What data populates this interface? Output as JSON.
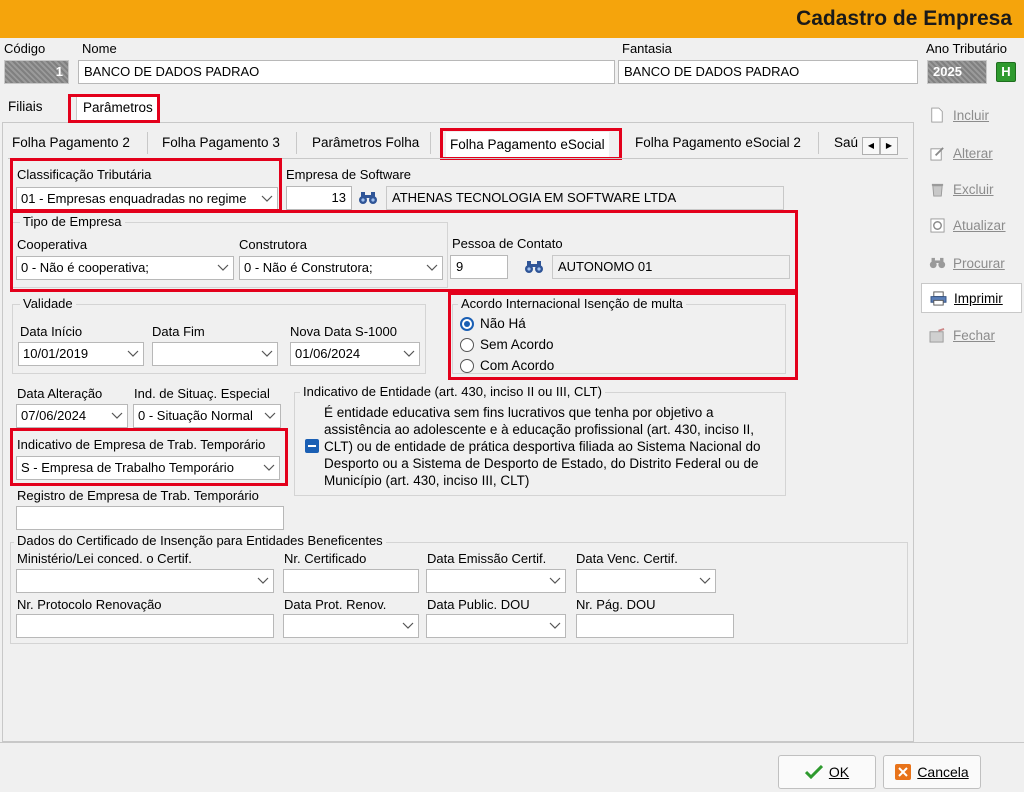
{
  "window": {
    "title": "Cadastro de Empresa"
  },
  "header": {
    "codigo_label": "Código",
    "codigo_value": "1",
    "nome_label": "Nome",
    "nome_value": "BANCO DE DADOS PADRAO",
    "fantasia_label": "Fantasia",
    "fantasia_value": "BANCO DE DADOS PADRAO",
    "ano_label": "Ano Tributário",
    "ano_value": "2025",
    "ano_badge": "H"
  },
  "top_tabs": [
    "Filiais",
    "Parâmetros"
  ],
  "sub_tabs": [
    "Folha Pagamento 2",
    "Folha Pagamento 3",
    "Parâmetros Folha",
    "Folha Pagamento eSocial",
    "Folha Pagamento eSocial 2",
    "Saú"
  ],
  "form": {
    "classificacao_label": "Classificação Tributária",
    "classificacao_value": "01 - Empresas enquadradas no regime",
    "empresa_software_label": "Empresa de Software",
    "empresa_software_code": "13",
    "empresa_software_name": "ATHENAS TECNOLOGIA EM SOFTWARE LTDA",
    "tipo_empresa_title": "Tipo de Empresa",
    "cooperativa_label": "Cooperativa",
    "cooperativa_value": "0 - Não é cooperativa;",
    "construtora_label": "Construtora",
    "construtora_value": "0 - Não é Construtora;",
    "pessoa_contato_label": "Pessoa de Contato",
    "pessoa_contato_code": "9",
    "pessoa_contato_name": "AUTONOMO 01",
    "validade_title": "Validade",
    "data_inicio_label": "Data Início",
    "data_inicio_value": "10/01/2019",
    "data_fim_label": "Data Fim",
    "data_fim_value": "",
    "nova_data_label": "Nova Data S-1000",
    "nova_data_value": "01/06/2024",
    "acordo_title": "Acordo Internacional Isenção de multa",
    "acordo_options": [
      "Não Há",
      "Sem Acordo",
      "Com Acordo"
    ],
    "acordo_selected": "Não Há",
    "data_alteracao_label": "Data Alteração",
    "data_alteracao_value": "07/06/2024",
    "ind_situac_label": "Ind. de Situaç. Especial",
    "ind_situac_value": "0 - Situação Normal",
    "indicativo_entidade_title": "Indicativo de Entidade (art. 430, inciso II ou III, CLT)",
    "indicativo_entidade_text": "É entidade educativa sem fins lucrativos que tenha por objetivo a assistência ao adolescente e à educação profissional (art. 430, inciso II, CLT) ou de entidade de prática desportiva filiada ao Sistema Nacional do Desporto ou a Sistema de Desporto de Estado, do Distrito Federal ou de Município (art. 430, inciso III, CLT)",
    "trab_temp_label": "Indicativo de Empresa de Trab. Temporário",
    "trab_temp_value": "S - Empresa de Trabalho Temporário",
    "registro_label": "Registro de Empresa de Trab. Temporário",
    "registro_value": "",
    "certificado_title": "Dados do Certificado de Insenção para Entidades Beneficentes",
    "ministerio_label": "Ministério/Lei conced. o Certif.",
    "nr_cert_label": "Nr. Certificado",
    "data_emissao_label": "Data Emissão Certif.",
    "data_venc_label": "Data Venc. Certif.",
    "nr_protocolo_label": "Nr. Protocolo Renovação",
    "data_prot_label": "Data Prot. Renov.",
    "data_public_label": "Data Public. DOU",
    "nr_pag_label": "Nr. Pág. DOU"
  },
  "sidebar": {
    "incluir": "Incluir",
    "alterar": "Alterar",
    "excluir": "Excluir",
    "atualizar": "Atualizar",
    "procurar": "Procurar",
    "imprimir": "Imprimir",
    "fechar": "Fechar"
  },
  "footer": {
    "ok": "OK",
    "cancela": "Cancela"
  },
  "colors": {
    "title_bar": "#f5a40c",
    "highlight": "#e3001b",
    "accent": "#1a5fb4"
  }
}
